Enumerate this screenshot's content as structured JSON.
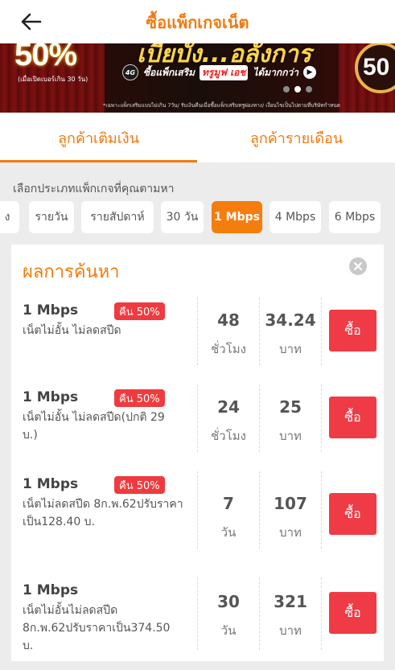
{
  "header": {
    "title": "ซื้อแพ็กเกจเน็ต",
    "back_icon": "arrow-left-icon"
  },
  "banner": {
    "percent": "50%",
    "note": "(เมื่อเปิดเบอร์เกิน 30 วัน)",
    "headline": "เบียบัง...อลังการ",
    "badge_4g": "4G",
    "sub_text": "ซื้อแพ็กเสริม",
    "brand": "ทรูมูฟ เอช",
    "sub_tail": "ได้มากกว่า",
    "footnote": "*เฉพาะแพ็กเสริมแบบไม่เกิน 7วัน/ รับเงินคืนเมื่อซื้อแพ็กเสริมทรูผ่องทาง/ เงื่อนไขเป็นไปตามที่บริษัทกำหนด",
    "right_number": "50"
  },
  "tabs": [
    {
      "label": "ลูกค้าเติมเงิน",
      "active": true
    },
    {
      "label": "ลูกค้ารายเดือน",
      "active": false
    }
  ],
  "filter": {
    "label": "เลือกประเภทแพ็กเกจที่คุณตามหา",
    "chips": [
      {
        "label": "ง",
        "active": false
      },
      {
        "label": "รายวัน",
        "active": false
      },
      {
        "label": "รายสัปดาห์",
        "active": false
      },
      {
        "label": "30 วัน",
        "active": false
      },
      {
        "label": "1 Mbps",
        "active": true
      },
      {
        "label": "4 Mbps",
        "active": false
      },
      {
        "label": "6 Mbps",
        "active": false
      }
    ]
  },
  "results": {
    "title": "ผลการค้นหา",
    "accent": "#f07a10",
    "buy_color": "#ef3b45",
    "items": [
      {
        "speed": "1 Mbps",
        "badge": "คืน 50%",
        "desc": "เน็ตไม่อั้น ไม่ลดสปีด",
        "duration": "48",
        "duration_unit": "ชั่วโมง",
        "price": "34.24",
        "price_unit": "บาท",
        "buy_label": "ซื้อ"
      },
      {
        "speed": "1 Mbps",
        "badge": "คืน 50%",
        "desc": "เน็ตไม่อั้น ไม่ลดสปีด(ปกติ 29 บ.)",
        "duration": "24",
        "duration_unit": "ชั่วโมง",
        "price": "25",
        "price_unit": "บาท",
        "buy_label": "ซื้อ"
      },
      {
        "speed": "1 Mbps",
        "badge": "คืน 50%",
        "desc": "เน็ตไม่ลดสปีด 8ก.พ.62ปรับราคาเป็น128.40 บ.",
        "duration": "7",
        "duration_unit": "วัน",
        "price": "107",
        "price_unit": "บาท",
        "buy_label": "ซื้อ"
      },
      {
        "speed": "1 Mbps",
        "badge": "",
        "desc": "เน็ตไม่อั้นไม่ลดสปีด 8ก.พ.62ปรับราคาเป็น374.50 บ.",
        "duration": "30",
        "duration_unit": "วัน",
        "price": "321",
        "price_unit": "บาท",
        "buy_label": "ซื้อ"
      }
    ]
  }
}
